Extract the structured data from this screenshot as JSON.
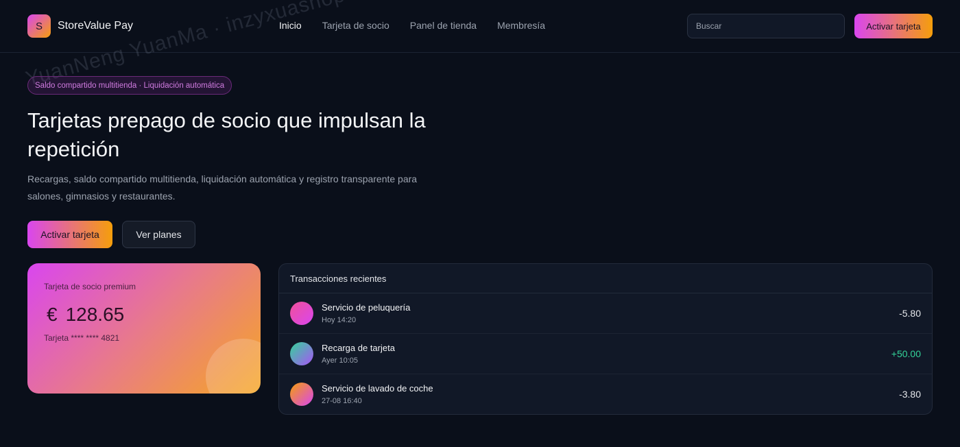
{
  "brand": {
    "logo_letter": "S",
    "name": "StoreValue Pay"
  },
  "nav": {
    "items": [
      {
        "label": "Inicio",
        "active": true
      },
      {
        "label": "Tarjeta de socio",
        "active": false
      },
      {
        "label": "Panel de tienda",
        "active": false
      },
      {
        "label": "Membresía",
        "active": false
      }
    ]
  },
  "search": {
    "placeholder": "Buscar",
    "value": ""
  },
  "header": {
    "cta_label": "Activar tarjeta"
  },
  "watermark": "YuanNeng YuanMa · inzyxuashop.com",
  "hero": {
    "badge": "Saldo compartido multitienda · Liquidación automática",
    "title": "Tarjetas prepago de socio que impulsan la repetición",
    "subtitle": "Recargas, saldo compartido multitienda, liquidación automática y registro transparente para salones, gimnasios y restaurantes.",
    "primary_cta": "Activar tarjeta",
    "secondary_cta": "Ver planes"
  },
  "card": {
    "label": "Tarjeta de socio premium",
    "currency": "€",
    "balance": "128.65",
    "number": "Tarjeta **** **** 4821"
  },
  "transactions": {
    "title": "Transacciones recientes",
    "items": [
      {
        "name": "Servicio de peluquería",
        "time": "Hoy 14:20",
        "amount": "-5.80"
      },
      {
        "name": "Recarga de tarjeta",
        "time": "Ayer 10:05",
        "amount": "+50.00"
      },
      {
        "name": "Servicio de lavado de coche",
        "time": "27-08 16:40",
        "amount": "-3.80"
      }
    ]
  },
  "colors": {
    "background": "#0a0f1a",
    "accent_start": "#d946ef",
    "accent_end": "#f59e0b",
    "positive": "#34d399"
  }
}
